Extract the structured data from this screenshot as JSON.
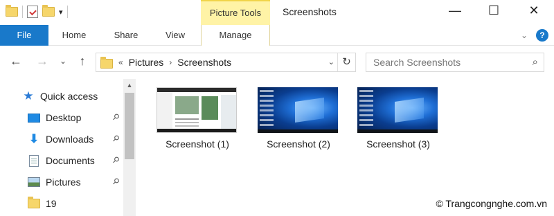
{
  "window": {
    "title": "Screenshots",
    "context_tab_group": "Picture Tools",
    "qat_dropdown": "▾",
    "controls": {
      "minimize": "—",
      "maximize": "☐",
      "close": "✕"
    }
  },
  "ribbon": {
    "tabs": [
      {
        "label": "File"
      },
      {
        "label": "Home"
      },
      {
        "label": "Share"
      },
      {
        "label": "View"
      },
      {
        "label": "Manage"
      }
    ],
    "collapse_icon": "⌄",
    "help_icon": "?"
  },
  "nav": {
    "back": "←",
    "forward": "→",
    "recent": "⌄",
    "up": "↑"
  },
  "address": {
    "prefix": "«",
    "path": [
      "Pictures",
      "Screenshots"
    ],
    "separator": "›",
    "dropdown": "⌄",
    "refresh": "↻"
  },
  "search": {
    "placeholder": "Search Screenshots",
    "icon": "⌕"
  },
  "sidebar": {
    "items": [
      {
        "label": "Quick access",
        "icon": "star-icon",
        "pinned": false
      },
      {
        "label": "Desktop",
        "icon": "desktop-icon",
        "pinned": true
      },
      {
        "label": "Downloads",
        "icon": "downloads-icon",
        "pinned": true
      },
      {
        "label": "Documents",
        "icon": "documents-icon",
        "pinned": true
      },
      {
        "label": "Pictures",
        "icon": "pictures-icon",
        "pinned": true
      },
      {
        "label": "19",
        "icon": "folder-icon",
        "pinned": false
      }
    ],
    "pin_glyph": "📌",
    "scroll_up": "▲"
  },
  "files": [
    {
      "name": "Screenshot (1)",
      "thumbnail": "browser-window"
    },
    {
      "name": "Screenshot (2)",
      "thumbnail": "windows-desktop"
    },
    {
      "name": "Screenshot (3)",
      "thumbnail": "windows-desktop"
    }
  ],
  "watermark": "© Trangcongnghe.com.vn",
  "colors": {
    "file_tab": "#1979ca",
    "context_tab": "#fff3a6",
    "folder": "#f6d66b"
  }
}
